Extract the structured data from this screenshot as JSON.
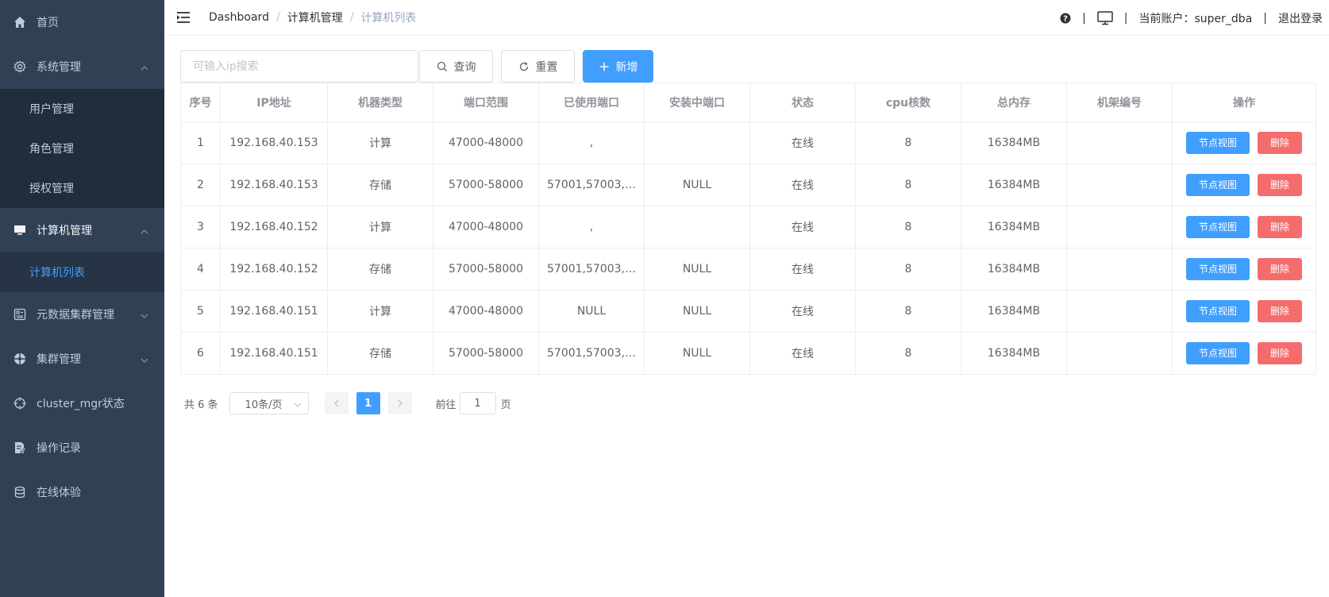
{
  "sidebar": {
    "home": "首页",
    "system": {
      "label": "系统管理",
      "items": [
        "用户管理",
        "角色管理",
        "授权管理"
      ]
    },
    "computer": {
      "label": "计算机管理",
      "items": [
        "计算机列表"
      ]
    },
    "metadata_cluster": "元数据集群管理",
    "cluster": "集群管理",
    "cluster_mgr": "cluster_mgr状态",
    "oplog": "操作记录",
    "online_trial": "在线体验"
  },
  "header": {
    "breadcrumb": [
      "Dashboard",
      "计算机管理",
      "计算机列表"
    ],
    "breadcrumb_sep": "/",
    "account_label": "当前账户：super_dba",
    "logout": "退出登录",
    "sep": "|"
  },
  "toolbar": {
    "search_placeholder": "可输入ip搜索",
    "query_label": "查询",
    "reset_label": "重置",
    "add_label": "新增"
  },
  "table": {
    "columns": [
      "序号",
      "IP地址",
      "机器类型",
      "端口范围",
      "已使用端口",
      "安装中端口",
      "状态",
      "cpu核数",
      "总内存",
      "机架编号",
      "操作"
    ],
    "rows": [
      {
        "index": "1",
        "ip": "192.168.40.153",
        "type": "计算",
        "port_range": "47000-48000",
        "used_ports": ",",
        "installing_ports": "",
        "status": "在线",
        "cpu": "8",
        "memory": "16384MB",
        "rack": ""
      },
      {
        "index": "2",
        "ip": "192.168.40.153",
        "type": "存储",
        "port_range": "57000-58000",
        "used_ports": "57001,57003,5...",
        "installing_ports": "NULL",
        "status": "在线",
        "cpu": "8",
        "memory": "16384MB",
        "rack": ""
      },
      {
        "index": "3",
        "ip": "192.168.40.152",
        "type": "计算",
        "port_range": "47000-48000",
        "used_ports": ",",
        "installing_ports": "",
        "status": "在线",
        "cpu": "8",
        "memory": "16384MB",
        "rack": ""
      },
      {
        "index": "4",
        "ip": "192.168.40.152",
        "type": "存储",
        "port_range": "57000-58000",
        "used_ports": "57001,57003,5...",
        "installing_ports": "NULL",
        "status": "在线",
        "cpu": "8",
        "memory": "16384MB",
        "rack": ""
      },
      {
        "index": "5",
        "ip": "192.168.40.151",
        "type": "计算",
        "port_range": "47000-48000",
        "used_ports": "NULL",
        "installing_ports": "NULL",
        "status": "在线",
        "cpu": "8",
        "memory": "16384MB",
        "rack": ""
      },
      {
        "index": "6",
        "ip": "192.168.40.151",
        "type": "存储",
        "port_range": "57000-58000",
        "used_ports": "57001,57003,5...",
        "installing_ports": "NULL",
        "status": "在线",
        "cpu": "8",
        "memory": "16384MB",
        "rack": ""
      }
    ],
    "view_label": "节点视图",
    "delete_label": "删除"
  },
  "pagination": {
    "total": "共 6 条",
    "page_size": "10条/页",
    "current_page": "1",
    "goto_prefix": "前往",
    "goto_value": "1",
    "goto_suffix": "页"
  },
  "colors": {
    "sidebar_bg": "#304156",
    "submenu_bg": "#1f2d3d",
    "primary": "#409eff",
    "danger": "#f56c6c",
    "success": "#67c23a"
  }
}
